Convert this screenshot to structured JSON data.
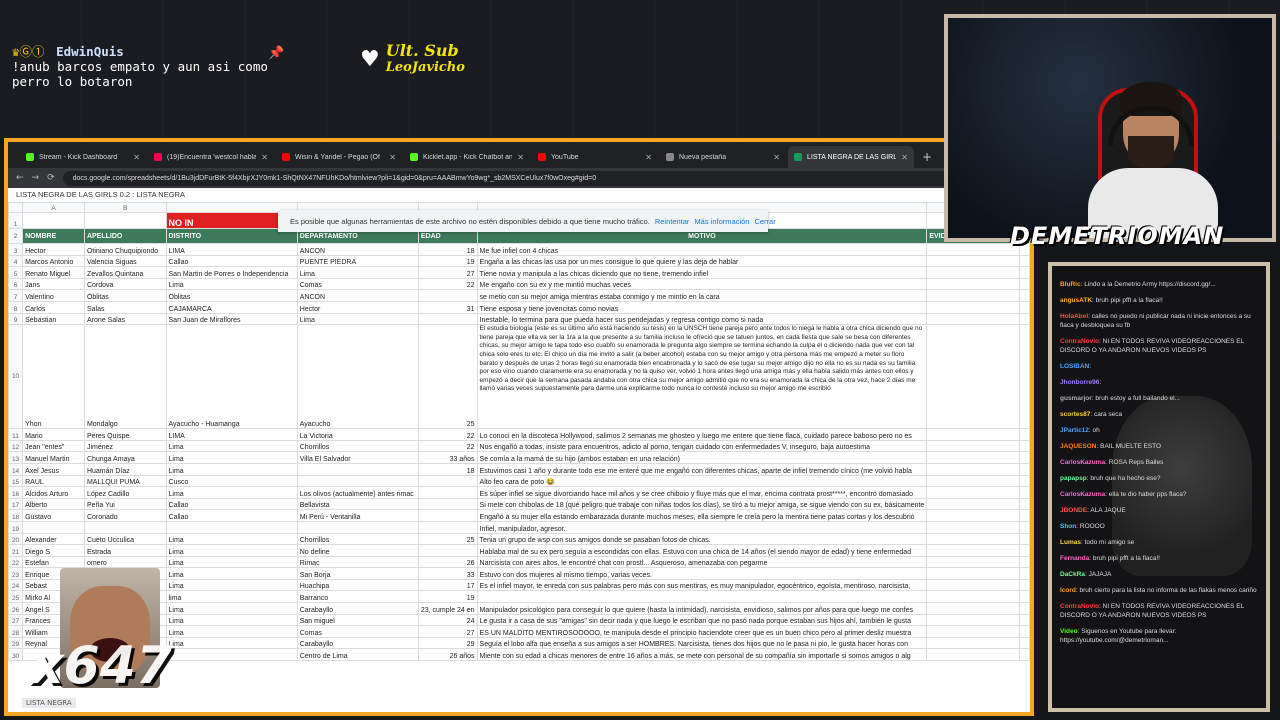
{
  "overlay": {
    "chat_user": "EdwinQuis",
    "chat_badges": "♛Ⓖ①",
    "chat_line1": "!anub barcos empato y aun asi como",
    "chat_line2": "perro lo botaron",
    "ult_sub_title": "Ult. Sub",
    "ult_sub_name": "LeoJavicho",
    "streamer_name": "DEMETRIOMAN",
    "combo_text": "x647",
    "colors": {
      "frame": "#f5a623",
      "sheet_header": "#3d7a5a",
      "name_banner": "#ffffff"
    }
  },
  "browser": {
    "tabs": [
      {
        "label": "Stream - Kick Dashboard",
        "color": "#53fc18"
      },
      {
        "label": "(19)Encuentra 'westcol habla m",
        "color": "#ff0050"
      },
      {
        "label": "Wisin & Yandel - Pegao (Of",
        "color": "#ff0000"
      },
      {
        "label": "Kicklet.app - Kick Chatbot and",
        "color": "#53fc18"
      },
      {
        "label": "YouTube",
        "color": "#ff0000"
      },
      {
        "label": "Nueva pestaña",
        "color": "#888888"
      },
      {
        "label": "LISTA NEGRA DE LAS GIRLS 0.2",
        "color": "#0f9d58"
      }
    ],
    "url": "docs.google.com/spreadsheets/d/1Bu3jdDFurBtK-5f4XbjrXJY0mk1-ShQtNX47NFUhKDo/htmlview?pli=1&gid=0&pru=AAABmwYo9wg*_sb2MSXCeUlux7f0wOxeg#gid=0",
    "sheet_title": "LISTA NEGRA DE LAS GIRLS 0.2 : LISTA NEGRA",
    "sheet_tab": "LISTA NEGRA"
  },
  "notice": {
    "text": "Es posible que algunas herramientas de este archivo no estén disponibles debido a que tiene mucho tráfico.",
    "retry": "Reintentar",
    "more": "Más información",
    "close": "Cerrar"
  },
  "sheet": {
    "col_letters": [
      "A",
      "B",
      "",
      "",
      "",
      "",
      "G"
    ],
    "row1_banner": "NO IN",
    "headers": [
      "NOMBRE",
      "APELLIDO",
      "DISTRITO",
      "DEPARTAMENTO",
      "EDAD",
      "MOTIVO",
      "EVIDENCIA (OPCIONAL)"
    ],
    "rows": [
      [
        "3",
        "Hector",
        "Otiniano Chuquipiondo",
        "LIMA",
        "ANCON",
        "18",
        "Me fue infiel con 4 chicas"
      ],
      [
        "4",
        "Marcos Antonio",
        "Valencia Siguas",
        "Callao",
        "PUENTE PIEDRA",
        "19",
        "Engaña a las chicas las usa por un mes consigue lo que quiere y las deja de hablar"
      ],
      [
        "5",
        "Renato Miguel",
        "Zevallos Quintana",
        "San Martin de Porres o Independencia",
        "Lima",
        "27",
        "Tiene novia y manipula a las chicas diciendo que no tiene, tremendo infiel"
      ],
      [
        "6",
        "Jans",
        "Cordova",
        "Lima",
        "Comas",
        "22",
        "Me engaño con su ex y me mintió muchas veces"
      ],
      [
        "7",
        "Valentino",
        "Oblitas",
        "Oblitas",
        "ANCON",
        "",
        "se metio con su mejor amiga mientras estaba conmigo y me mintio en la cara"
      ],
      [
        "8",
        "Carlos",
        "Salas",
        "CAJAMARCA",
        "Hector",
        "31",
        "Tiene esposa y tiene jovencitas como novias"
      ],
      [
        "9",
        "Sebastian",
        "Arone Salas",
        "San Juan de Miraflores",
        "Lima",
        "",
        "Inestable, lo termina para que pueda hacer sus pendejadas y regresa contigo como si nada"
      ],
      [
        "11",
        "Mario",
        "Peres Quispe",
        "LIMA",
        "La Victoria",
        "22",
        "Lo conoci en la discoteca Hollywood, salimos 2 semanas me ghosteo y luego me entere que tiene flaca, cuidado parece baboso pero no es"
      ],
      [
        "12",
        "Jean \"entes\"",
        "Jiménez",
        "Lima",
        "Chorrillos",
        "22",
        "Nos engañó a todas, insiste para encuentros, adicto al porno, tengan cuidado con enfermedades V, inseguro, baja autoestima"
      ],
      [
        "13",
        "Manuel Martin",
        "Chunga Amaya",
        "Lima",
        "Villa El Salvador",
        "33 años",
        "Se comía a la mamá de su hijo (ambos estaban en una relación)"
      ],
      [
        "14",
        "Axel Jesus",
        "Huamán Díaz",
        "Lima",
        "",
        "18",
        "Estuvimos casi 1 año y durante todo ese me enteré que me engañó con diferentes chicas, aparte de infiel tremendo cínico (me volvió habla"
      ],
      [
        "15",
        "RAUL",
        "MALLQUI PUMA",
        "Cusco",
        "",
        "",
        "Alto feo cara de poto 😂"
      ],
      [
        "16",
        "Alcidos Arturo",
        "López Cadillo",
        "Lima",
        "Los olivos (actualmente) antes rimac",
        "",
        "Es súper infiel se sigue divorciando hace mil años y se cree chiboio y fluye más que el mar, encima contrata prost*****, encontró domasiado"
      ],
      [
        "17",
        "Alberto",
        "Peña Yui",
        "Callao",
        "Bellavista",
        "",
        "Si mete con chibolas de 18 (qué peligro que trabaje con niñas todos los días), se tíró a tu mejor amiga, se sigue viendo con su ex, básicamente"
      ],
      [
        "18",
        "Gustavo",
        "Coronado",
        "Callao",
        "Mi Perú - Ventanilla",
        "",
        "Engañó a su mujer ella estando embarazada durante muchos meses, ella siempre le creía pero la mentira tiene patas cortas y los descubrió"
      ],
      [
        "20",
        "Alexander",
        "Cueto Ucculica",
        "Lima",
        "Chorrillos",
        "25",
        "Tenia un grupo de wsp con sus amigos donde se pasaban fotos de chicas."
      ],
      [
        "21",
        "Diego S",
        "Estrada",
        "Lima",
        "No define",
        "",
        "Hablaba mal de su ex pero seguía a escondidas con ellas. Estuvo con una chica de 14 años (el siendo mayor de edad) y tiene enfermedad"
      ],
      [
        "22",
        "Estefan",
        "omero",
        "Lima",
        "Rimac",
        "26",
        "Narcisista con aires altos, le encontré chat con prostl... Asqueroso, amenazaba con pegarme"
      ],
      [
        "23",
        "Enrique",
        "oque",
        "Lima",
        "San Borja",
        "33",
        "Estuvo con dos mujeres al mismo tiempo, varias veces."
      ],
      [
        "24",
        "Sebast",
        "Gonzales",
        "Lima",
        "Huachipa",
        "17",
        "Es el infiel mayor, te enreda con sus palabras pero más con sus mentiras, es muy manipulador, egocéntrico, egoísta, mentiroso, narcisista,"
      ],
      [
        "25",
        "Mirko Al",
        "Güich",
        "lima",
        "Barranco",
        "19",
        ""
      ],
      [
        "26",
        "Angel S",
        "ayo",
        "Lima",
        "Carabayllo",
        "23, cumple 24 en",
        "Manipulador psicológico para conseguir lo que quiere (hasta la intimidad), narcisista, envidioso, salimos por años para que luego me confes"
      ],
      [
        "27",
        "Frances",
        "",
        "Lima",
        "San miguel",
        "24",
        "Le gusta ir a casa de sus \"amigas\" sin decir nada y que luego le escriban que no pasó nada porque estaban sus hijos ahí, también le gusta"
      ],
      [
        "28",
        "William",
        "",
        "Lima",
        "Comas",
        "27",
        "ES UN MALDITO MENTIROSOOOOO, te manipula desde el principio haciendote creer que es un buen chico pero al primer desliz muestra"
      ],
      [
        "29",
        "Reynal",
        "wida",
        "Lima",
        "Carabayllo",
        "29",
        "Seguía el lobo alfa que enseña a sus amigos a ser HOMBRES. Narcisista, tienes dos hijos que no le pasa ni pio, le gusta hacer horas con"
      ],
      [
        "30",
        "",
        "illo",
        "",
        "Centro de Lima",
        "26 años",
        "Miente con su edad a chicas menores de entre 16 años a más, se mete con personal de su compañía sin importarle si somos amigos o alg"
      ]
    ],
    "row10": {
      "num": "10",
      "nombre": "Yhon",
      "apellido": "Mondalgo",
      "distrito": "Ayacucho - Huamanga",
      "departamento": "Ayacucho",
      "edad": "25",
      "motivo": "El estudia biología (este es su último año está haciendo su tesis) en la UNSCH tiene pareja pero ante todos lo niega le habla a otra chica diciendo que no tiene pareja que ella va ser la 1ra a la que presente a su familia incluso le ofreció que se tatuen juntos, en cada fiesta que sale se besa con diferentes chicas, su mejor amigo le tapa todo eso cuabfo su enamorada le pregunta algo siempre se termina echando la culpa él o diciendo nada que ver con tal chica solo eres tu etc. El chico un día me invitó a salir (a beber alcohol) estaba con su mejor amigo y otra persona más me empezó a meter su floro barato y después de unas 2 horas llegó su enamorada bien encabronada y lo sacó de ese lugar su mejor amigo dijo no ella no es su nada es su familia por eso vino cuando claramente era su enamorada y no la quiso ver, volvió 1 hora antes llegó una amiga más y ella había salido más antes con ellos y empezó a decir que la semana pasada andaba con otra chica su mejor amigo admitió que no era su enamorada la chica de la otra vez, hace 2 días me llamó varias veces supuestamente para darme una explicarme todo nunca lo contesté incluso su mejor amigo me escribió"
    },
    "row19": {
      "num": "19",
      "motivo": "Infiel, manipulador, agresor."
    }
  },
  "side_chat": [
    {
      "user": "BluRic",
      "text": "Lindo a la Demetrio Army https://discord.gg/...",
      "color": "#ff9f1c"
    },
    {
      "user": "angusATK",
      "text": "bruh pipi pfft a la flaca!!",
      "color": "#ffb000"
    },
    {
      "user": "HolaAbel",
      "text": "calles no puedo ni publicar nada ni inicie entonces a su flaca y desbloquea su fb",
      "color": "#ff4d4d"
    },
    {
      "user": "ContraNovio",
      "text": "NI EN TODOS REVIVA VIDEOREACCIONES EL DISCORD O YA ANDARON NUEVOS VIDEOS PS",
      "color": "#ff3b3b"
    },
    {
      "user": "LOSIBAN",
      "text": "",
      "color": "#4aa3ff"
    },
    {
      "user": "Jhonborre96",
      "text": "",
      "color": "#9f7bff"
    },
    {
      "user": "gusmarjor",
      "text": "bruh estoy a full bailando el...",
      "color": "#b0b0b0"
    },
    {
      "user": "scortes87",
      "text": "cara seca",
      "color": "#ffcc33"
    },
    {
      "user": "JPartic12",
      "text": "oh",
      "color": "#4aa3ff"
    },
    {
      "user": "JAQUESON",
      "text": "BAIL MUELTE ESTO",
      "color": "#ff7b00"
    },
    {
      "user": "CarlosKazuma",
      "text": "ROSA Reps Bailes",
      "color": "#ff66cc"
    },
    {
      "user": "papapsp",
      "text": "bruh que ha hecho ese?",
      "color": "#66ff99"
    },
    {
      "user": "CarlosKazuma",
      "text": "ella te dio haber pps flaca?",
      "color": "#ff66cc"
    },
    {
      "user": "JBONDE",
      "text": "ALA JAQUE",
      "color": "#ff4d4d"
    },
    {
      "user": "Shon",
      "text": "ROOOO",
      "color": "#33ccff"
    },
    {
      "user": "Lumas",
      "text": "todo mi amigo se",
      "color": "#ffd24d"
    },
    {
      "user": "Fernanda",
      "text": "bruh pipi pfft a la flaca!!",
      "color": "#ff66cc"
    },
    {
      "user": "DaCkRa",
      "text": "JAJAJA",
      "color": "#66ff99"
    },
    {
      "user": "lcord",
      "text": "bruh cierto para la lista no informa de las flakas menos cariño",
      "color": "#ff9f1c"
    },
    {
      "user": "ContraNovio",
      "text": "NI EN TODOS REVIVA VIDEOREACCIONES EL DISCORD O YA ANDARON NUEVOS VIDEOS PS",
      "color": "#ff3b3b"
    },
    {
      "user": "Video",
      "text": "Siguenos en Youtube para llevar: https://youtube.com/@demetrioman...",
      "color": "#53fc18"
    }
  ]
}
